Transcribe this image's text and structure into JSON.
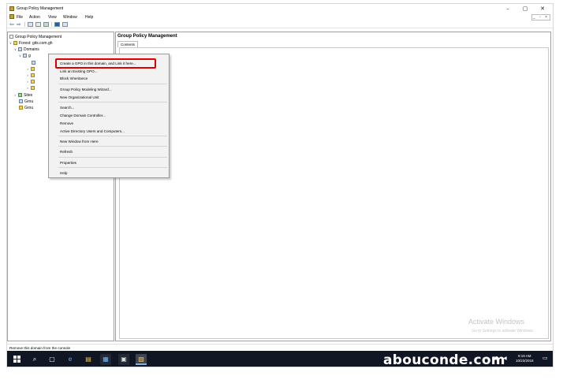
{
  "window": {
    "title": "Group Policy Management",
    "controls": {
      "minimize": "–",
      "maximize": "▢",
      "close": "✕"
    },
    "mdi_controls": "_ ▫ ×"
  },
  "menubar": [
    "File",
    "Action",
    "View",
    "Window",
    "Help"
  ],
  "tree": {
    "root": "Group Policy Management",
    "forest": "Forest: gits.com.gh",
    "domains": "Domains",
    "domain_partial": "g",
    "sites": "Sites",
    "gpo_modeling": "Grou",
    "gpo_results": "Grou"
  },
  "right_pane": {
    "title": "Group Policy Management",
    "tab": "Contents",
    "watermark_title": "Activate Windows",
    "watermark_sub": "Go to Settings to activate Windows."
  },
  "context_menu": [
    "Create a GPO in this domain, and Link it here...",
    "Link an Existing GPO...",
    "Block Inheritance",
    "Group Policy Modeling Wizard...",
    "New Organizational Unit",
    "Search...",
    "Change Domain Controller...",
    "Remove",
    "Active Directory Users and Computers...",
    "New Window from Here",
    "Refresh",
    "Properties",
    "Help"
  ],
  "statusbar": "Remove this domain from the console",
  "taskbar": {
    "brand": "abouconde.com",
    "time": "9:19 AM",
    "date": "10/23/2018"
  },
  "colors": {
    "highlight_border": "#e00000",
    "taskbar_bg": "#101624"
  }
}
